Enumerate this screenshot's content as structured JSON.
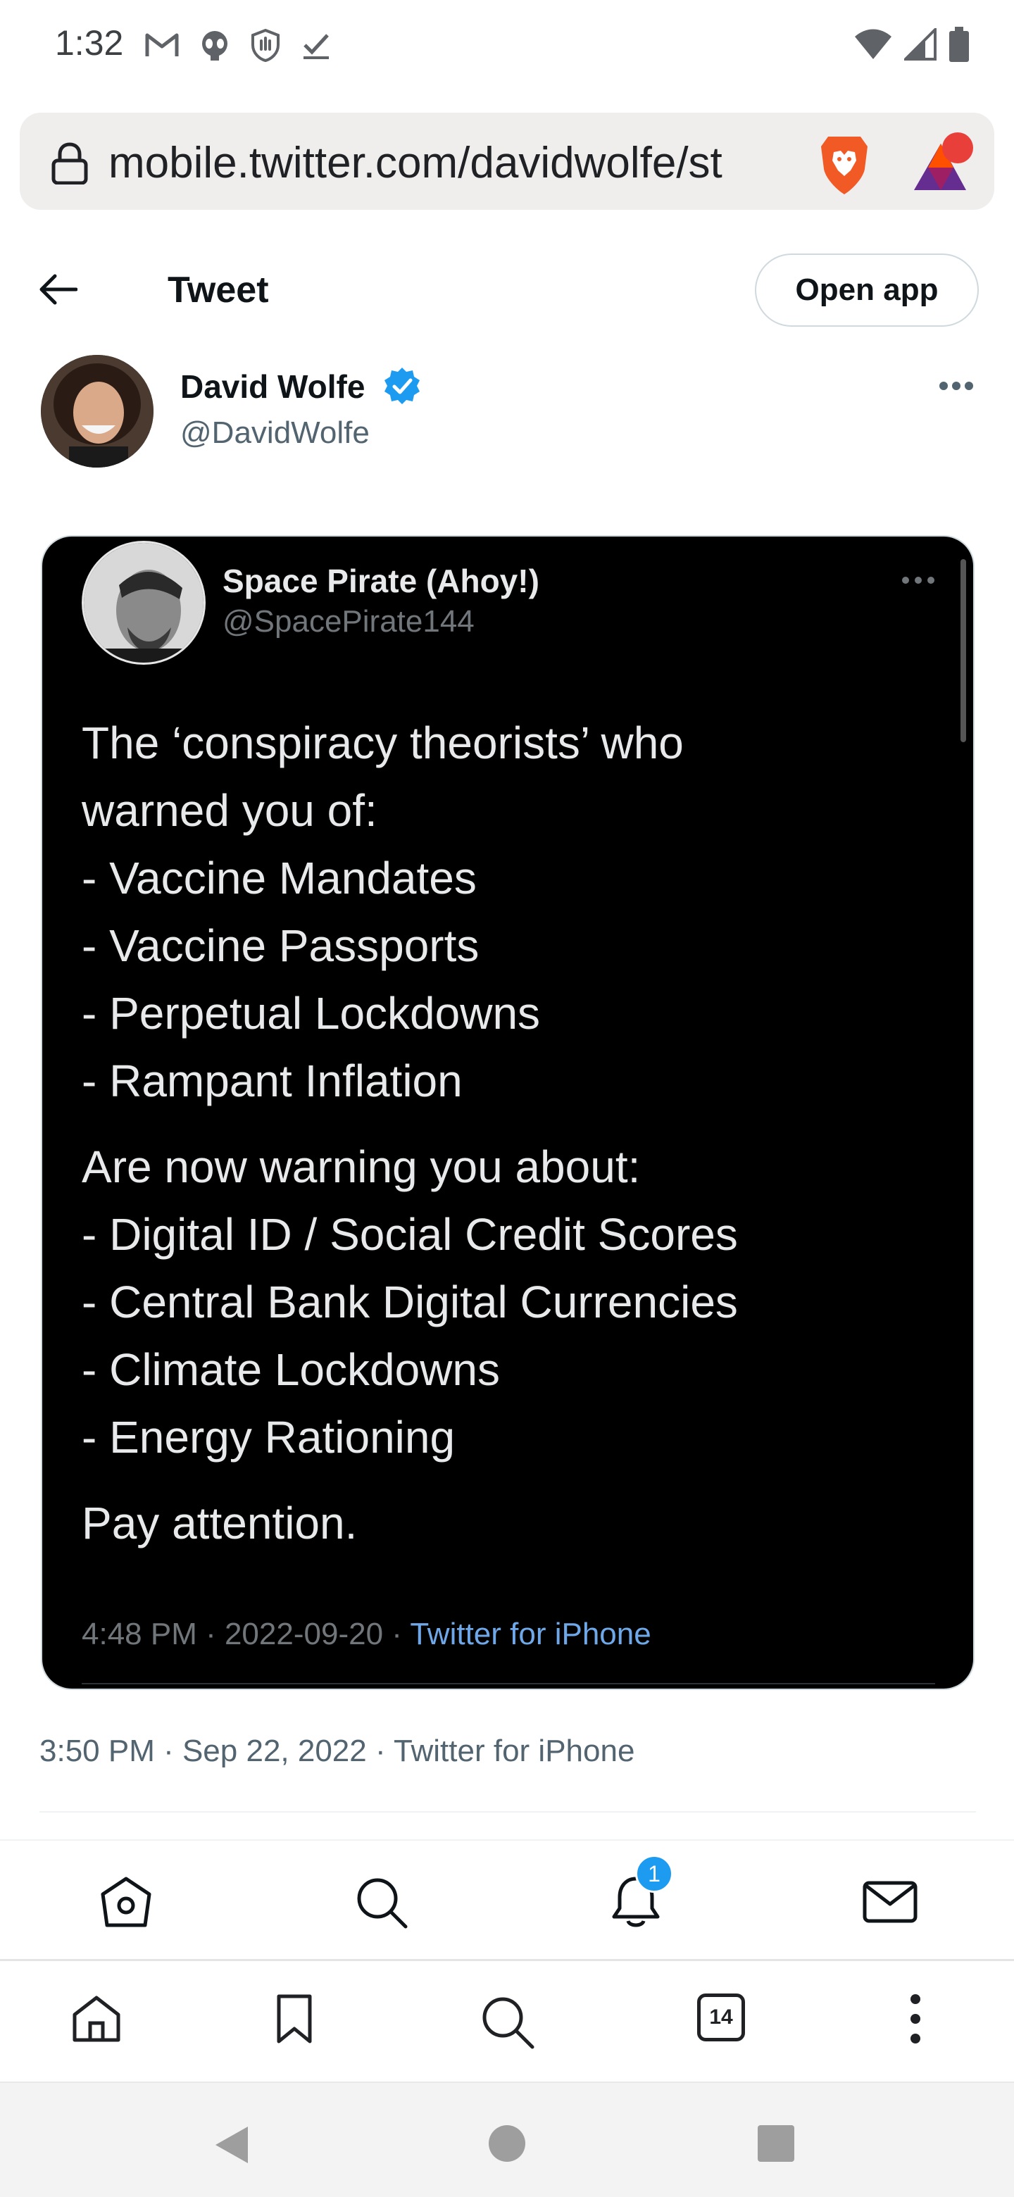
{
  "status_bar": {
    "time": "1:32",
    "left_icons": [
      "gmail-icon",
      "alien-icon",
      "shield-hand-icon",
      "check-icon"
    ],
    "right_icons": [
      "wifi-icon",
      "signal-icon",
      "battery-icon"
    ]
  },
  "browser": {
    "url": "mobile.twitter.com/davidwolfe/st",
    "tab_count": "14"
  },
  "header": {
    "title": "Tweet",
    "open_app_label": "Open app"
  },
  "author": {
    "name": "David Wolfe",
    "handle": "@DavidWolfe"
  },
  "embedded_tweet": {
    "name": "Space Pirate (Ahoy!)",
    "handle": "@SpacePirate144",
    "lines": [
      "The ‘conspiracy theorists’ who",
      "warned you of:",
      "- Vaccine Mandates",
      "- Vaccine Passports",
      "- Perpetual Lockdowns",
      "- Rampant Inflation",
      "Are now warning you about:",
      "- Digital ID / Social Credit Scores",
      "- Central Bank Digital Currencies",
      "- Climate Lockdowns",
      "- Energy Rationing",
      "Pay attention."
    ],
    "meta_time": "4:48 PM · 2022-09-20 · ",
    "meta_source": "Twitter for iPhone"
  },
  "tweet_meta": {
    "time": "3:50 PM · Sep 22, 2022 · Twitter for iPhone"
  },
  "bottom_nav": {
    "notification_count": "1"
  },
  "colors": {
    "twitter_blue": "#1d9bf0",
    "brave_orange": "#f15a24",
    "bat_red": "#e93f3a"
  }
}
